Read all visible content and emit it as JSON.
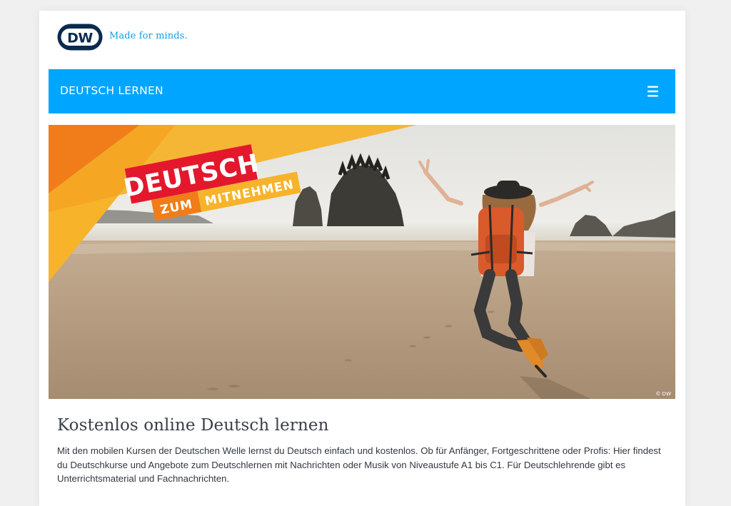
{
  "brand": {
    "logo_text": "DW",
    "tagline": "Made for minds."
  },
  "nav": {
    "title": "DEUTSCH LERNEN",
    "menu_icon": "hamburger-menu-icon"
  },
  "hero": {
    "badge_line1": "DEUTSCH",
    "badge_line2a": "ZUM",
    "badge_line2b": "MITNEHMEN",
    "copyright": "© DW"
  },
  "content": {
    "headline": "Kostenlos online Deutsch lernen",
    "intro": "Mit den mobilen Kursen der Deutschen Welle lernst du Deutsch einfach und kostenlos. Ob für Anfänger, Fortgeschrittene oder Profis: Hier findest du Deutschkurse und Angebote zum Deutschlernen mit Nachrichten oder Musik von Niveaustufe A1 bis C1. Für Deutschlehrende gibt es Unterrichtsmaterial und Fachnachrichten."
  },
  "colors": {
    "nav_blue": "#00a5ff",
    "tagline_blue": "#0a9fe8",
    "logo_navy": "#0b2a4f",
    "badge_red": "#e3182d",
    "badge_orange": "#f07d19",
    "badge_yellow": "#f7b32b"
  }
}
